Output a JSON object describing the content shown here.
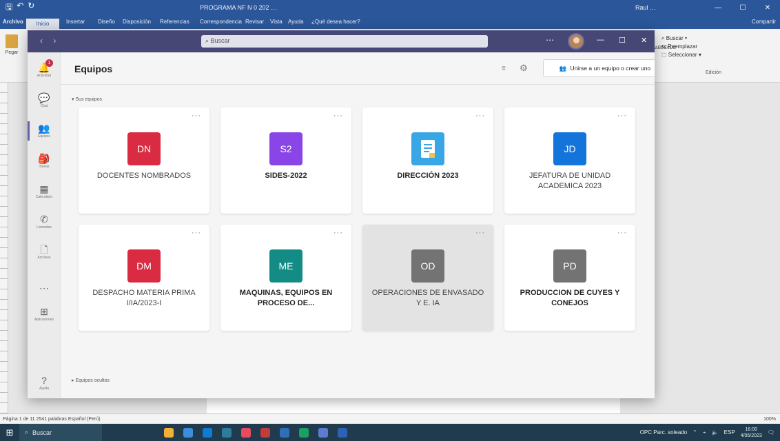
{
  "word": {
    "title_text": "PROGRAMA NF N 0 202 …",
    "user_text": "Raul …",
    "tabs": [
      "Archivo",
      "Inicio",
      "Insertar",
      "Diseño",
      "Disposición",
      "Referencias",
      "Correspondencia",
      "Revisar",
      "Vista",
      "Ayuda",
      "¿Qué desea hacer?"
    ],
    "share_label": "Compartir",
    "paste_label": "Pegar",
    "edit_items": [
      "Buscar",
      "Reemplazar",
      "Seleccionar"
    ],
    "edit_group": "Edición",
    "status_left": "Página 1 de 11   2541 palabras   Español (Perú)",
    "status_zoom": "100%"
  },
  "teams": {
    "search_placeholder": "Buscar",
    "page_title": "Equipos",
    "join_button": "Unirse a un equipo o crear uno",
    "section_yours": "Sus equipos",
    "section_hidden": "Equipos ocultos",
    "rail": [
      {
        "label": "Actividad",
        "glyph": "🔔"
      },
      {
        "label": "Chat",
        "glyph": "💬"
      },
      {
        "label": "Equipos",
        "glyph": "👥"
      },
      {
        "label": "Tareas",
        "glyph": "🎒"
      },
      {
        "label": "Calendario",
        "glyph": "▦"
      },
      {
        "label": "Llamadas",
        "glyph": "✆"
      },
      {
        "label": "Archivos",
        "glyph": "🗋"
      },
      {
        "label": "",
        "glyph": "⋯"
      },
      {
        "label": "Aplicaciones",
        "glyph": "⊞"
      },
      {
        "label": "Ayuda",
        "glyph": "?"
      }
    ],
    "badge_count": "1",
    "teams": [
      {
        "initials": "DN",
        "color": "#d92c43",
        "name": "DOCENTES NOMBRADOS",
        "bold": false
      },
      {
        "initials": "S2",
        "color": "#8a45e6",
        "name": "SIDES-2022",
        "bold": true
      },
      {
        "initials": "",
        "color": "#39a6e6",
        "name": "DIRECCIÓN 2023",
        "bold": true,
        "icon": "document-icon"
      },
      {
        "initials": "JD",
        "color": "#1374db",
        "name": "JEFATURA DE UNIDAD ACADEMICA 2023",
        "bold": false
      },
      {
        "initials": "DM",
        "color": "#d92c43",
        "name": "DESPACHO MATERIA PRIMA I/IA/2023-I",
        "bold": false
      },
      {
        "initials": "ME",
        "color": "#138c85",
        "name": "MAQUINAS, EQUIPOS EN PROCESO DE...",
        "bold": true
      },
      {
        "initials": "OD",
        "color": "#737373",
        "name": "OPERACIONES DE ENVASADO Y E. IA",
        "bold": false
      },
      {
        "initials": "PD",
        "color": "#737373",
        "name": "PRODUCCION DE CUYES Y CONEJOS",
        "bold": true
      }
    ]
  },
  "taskbar": {
    "search_placeholder": "Buscar",
    "tray_text": "OPC Parc. soleado",
    "lang": "ESP",
    "time": "16:00",
    "date": "4/05/2023",
    "app_colors": [
      "#f2b134",
      "#3c8dde",
      "#0f7cd4",
      "#2d7d9a",
      "#e84a5f",
      "#c43b3b",
      "#2f6fb5",
      "#1aa15f",
      "#5c7bd1",
      "#2a62b6"
    ]
  }
}
